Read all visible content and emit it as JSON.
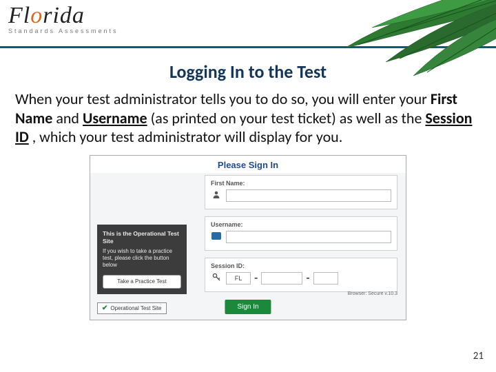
{
  "header": {
    "logo_main_1": "Fl",
    "logo_main_o": "o",
    "logo_main_2": "rida",
    "logo_sub": "Standards Assessments"
  },
  "title": "Logging In to the Test",
  "desc": {
    "p1": "When your test administrator tells you to do so, you will enter your ",
    "first_name": "First Name",
    "p2": " and ",
    "username": "Username",
    "p3": " (as printed on your test ticket) as well as the ",
    "session_id": "Session ID",
    "p4": ", which your test administrator will display for you."
  },
  "signin": {
    "heading": "Please Sign In",
    "first_name_label": "First Name:",
    "username_label": "Username:",
    "session_label": "Session ID:",
    "session_prefix": "FL",
    "sign_in_btn": "Sign In",
    "sidebar_heading": "This is the Operational Test Site",
    "sidebar_body": "If you wish to take a practice test, please click the button below",
    "practice_btn": "Take a Practice Test",
    "op_badge": "Operational Test Site",
    "browser_note": "Browser: Secure v.10.3"
  },
  "page_number": "21"
}
